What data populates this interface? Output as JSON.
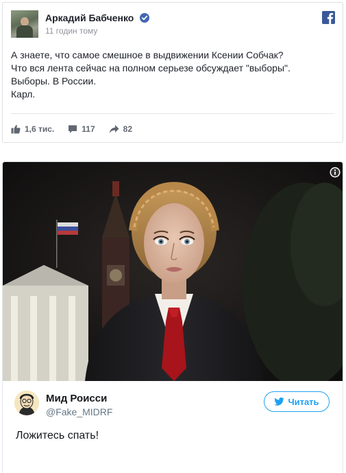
{
  "facebook_post": {
    "author": "Аркадий Бабченко",
    "timestamp": "11 годин тому",
    "body_lines": [
      "А знаете, что самое смешное в выдвижении Ксении Собчак?",
      "Что вся лента сейчас на полном серьезе обсуждает \"выборы\".",
      "Выборы. В России.",
      "Карл."
    ],
    "stats": {
      "likes": "1,6 тис.",
      "comments": "117",
      "shares": "82"
    },
    "icons": {
      "verified": "verified-badge-icon",
      "logo": "facebook-logo-icon",
      "like": "thumbs-up-icon",
      "comment": "comment-bubble-icon",
      "share": "share-arrow-icon"
    },
    "colors": {
      "facebook_blue": "#3b5998",
      "verified_blue": "#4267b2",
      "muted_text": "#90949c"
    }
  },
  "tweet": {
    "display_name": "Мид Роисси",
    "handle": "@Fake_MIDRF",
    "follow_label": "Читать",
    "text": "Ложитесь спать!",
    "icons": {
      "info": "info-icon",
      "follow": "twitter-bird-icon"
    },
    "colors": {
      "twitter_blue": "#1da1f2",
      "handle_gray": "#657786"
    }
  }
}
